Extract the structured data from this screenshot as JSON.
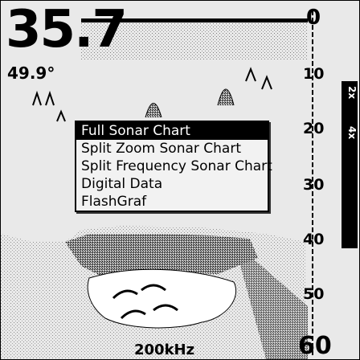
{
  "readout": {
    "depth": "35.7",
    "temperature": "49.9°"
  },
  "status": {
    "frequency": "200kHz"
  },
  "scale": {
    "ticks": [
      "0",
      "10",
      "20",
      "30",
      "40",
      "50",
      "60"
    ]
  },
  "zoom": {
    "options": [
      "2x",
      "4x"
    ]
  },
  "menu": {
    "items": [
      {
        "label": "Full Sonar Chart",
        "selected": true
      },
      {
        "label": "Split Zoom Sonar Chart",
        "selected": false
      },
      {
        "label": "Split Frequency Sonar Chart",
        "selected": false
      },
      {
        "label": "Digital Data",
        "selected": false
      },
      {
        "label": "FlashGraf",
        "selected": false
      }
    ]
  }
}
